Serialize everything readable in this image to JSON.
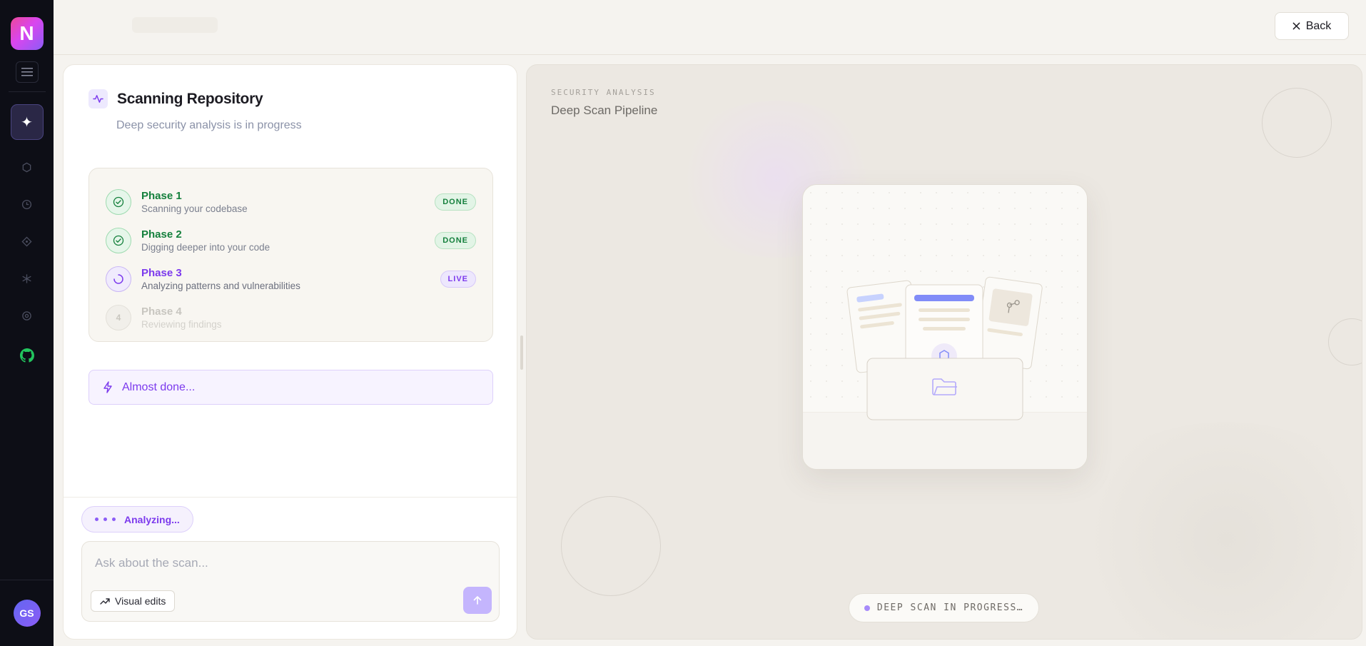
{
  "app": {
    "logo_letter": "N",
    "user_initials": "GS",
    "brand_gradient": [
      "#ec4899",
      "#8b5cf6"
    ]
  },
  "sidebar": {
    "nav_icons": [
      "hexagon-icon",
      "clock-icon",
      "diamond-icon",
      "sparkle-icon",
      "settings-icon",
      "github-icon"
    ]
  },
  "topbar": {
    "back_label": "Back"
  },
  "scan": {
    "title": "Scanning Repository",
    "subtitle": "Deep security analysis is in progress",
    "phases": [
      {
        "name": "Phase 1",
        "desc": "Scanning your codebase",
        "status": "DONE"
      },
      {
        "name": "Phase 2",
        "desc": "Digging deeper into your code",
        "status": "DONE"
      },
      {
        "name": "Phase 3",
        "desc": "Analyzing patterns and vulnerabilities",
        "status": "LIVE"
      },
      {
        "name": "Phase 4",
        "desc": "Reviewing findings",
        "status": "",
        "number": "4"
      }
    ],
    "almost_done": "Almost done..."
  },
  "chat": {
    "analyzing_label": "Analyzing...",
    "input_placeholder": "Ask about the scan...",
    "input_value": "",
    "visual_edits_label": "Visual edits"
  },
  "pipeline": {
    "eyebrow": "SECURITY ANALYSIS",
    "title": "Deep Scan Pipeline",
    "status": "DEEP SCAN IN PROGRESS…"
  },
  "colors": {
    "accent": "#7c3aed",
    "done": "#15803d",
    "sidebar_bg": "#0d0e16",
    "page_bg": "#f5f3ef"
  }
}
